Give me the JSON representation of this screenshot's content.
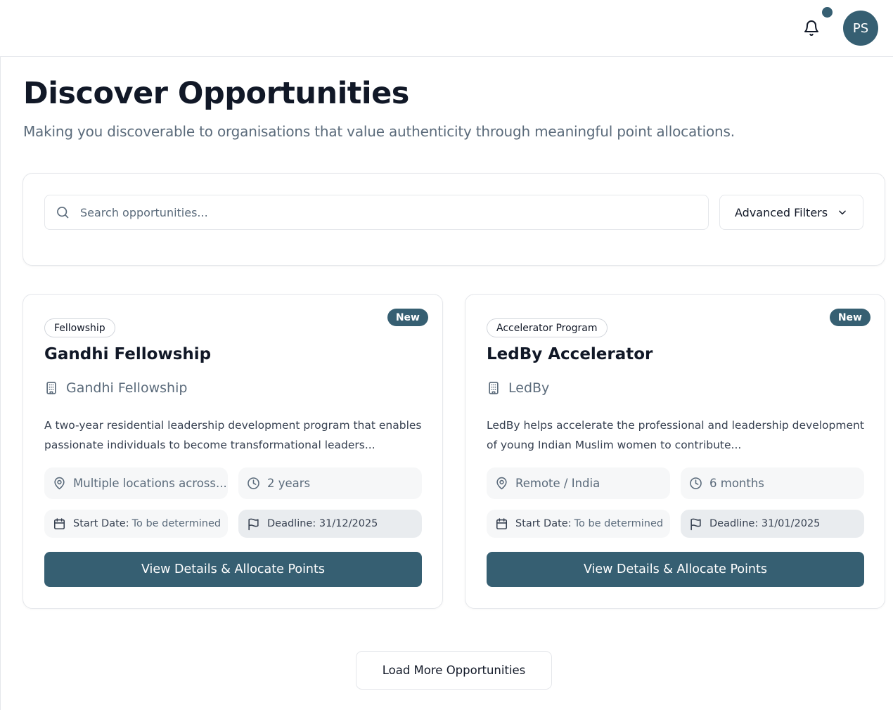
{
  "header": {
    "avatar_initials": "PS",
    "has_notification": true,
    "accent_color": "#365f72"
  },
  "page": {
    "title": "Discover Opportunities",
    "subtitle": "Making you discoverable to organisations that value authenticity through meaningful point allocations."
  },
  "search": {
    "placeholder": "Search opportunities...",
    "value": "",
    "filters_label": "Advanced Filters"
  },
  "opportunities": [
    {
      "badge": "New",
      "type": "Fellowship",
      "title": "Gandhi Fellowship",
      "organisation": "Gandhi Fellowship",
      "description": "A two-year residential leadership development program that enables passionate individuals to become transformational leaders...",
      "location": "Multiple locations across...",
      "duration": "2 years",
      "start_label": "Start Date:",
      "start_value": "To be determined",
      "deadline": "Deadline: 31/12/2025",
      "cta": "View Details & Allocate Points"
    },
    {
      "badge": "New",
      "type": "Accelerator Program",
      "title": "LedBy Accelerator",
      "organisation": "LedBy",
      "description": "LedBy helps accelerate the professional and leadership development of young Indian Muslim women to contribute...",
      "location": "Remote / India",
      "duration": "6 months",
      "start_label": "Start Date:",
      "start_value": "To be determined",
      "deadline": "Deadline: 31/01/2025",
      "cta": "View Details & Allocate Points"
    }
  ],
  "load_more_label": "Load More Opportunities",
  "icons": {
    "bell": "bell-icon",
    "search": "search-icon",
    "chevron": "chevron-down-icon",
    "building": "building-icon",
    "location": "map-pin-icon",
    "clock": "clock-icon",
    "calendar": "calendar-icon",
    "flag": "flag-icon"
  }
}
